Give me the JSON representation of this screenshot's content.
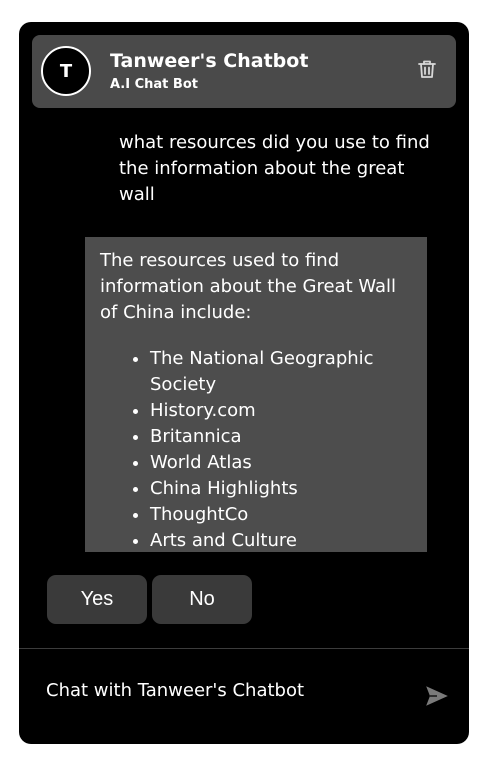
{
  "header": {
    "avatar_letter": "T",
    "title": "Tanweer's Chatbot",
    "subtitle": "A.I Chat Bot",
    "delete_icon": "trash-icon"
  },
  "messages": {
    "user": "what resources did you use to find the information about the great wall",
    "bot_intro": "The resources used to find information about the Great Wall of China include:",
    "bot_list": [
      "The National Geographic Society",
      "History.com",
      "Britannica",
      "World Atlas",
      "China Highlights",
      "ThoughtCo",
      "Arts and Culture"
    ]
  },
  "quick_replies": {
    "yes": "Yes",
    "no": "No"
  },
  "composer": {
    "placeholder": "Chat with Tanweer's Chatbot",
    "send_icon": "send-icon"
  },
  "colors": {
    "background": "#000000",
    "header_bg": "#4a4a4a",
    "bot_bubble_bg": "#4d4d4d",
    "button_bg": "#3a3a3a",
    "text": "#ffffff"
  }
}
